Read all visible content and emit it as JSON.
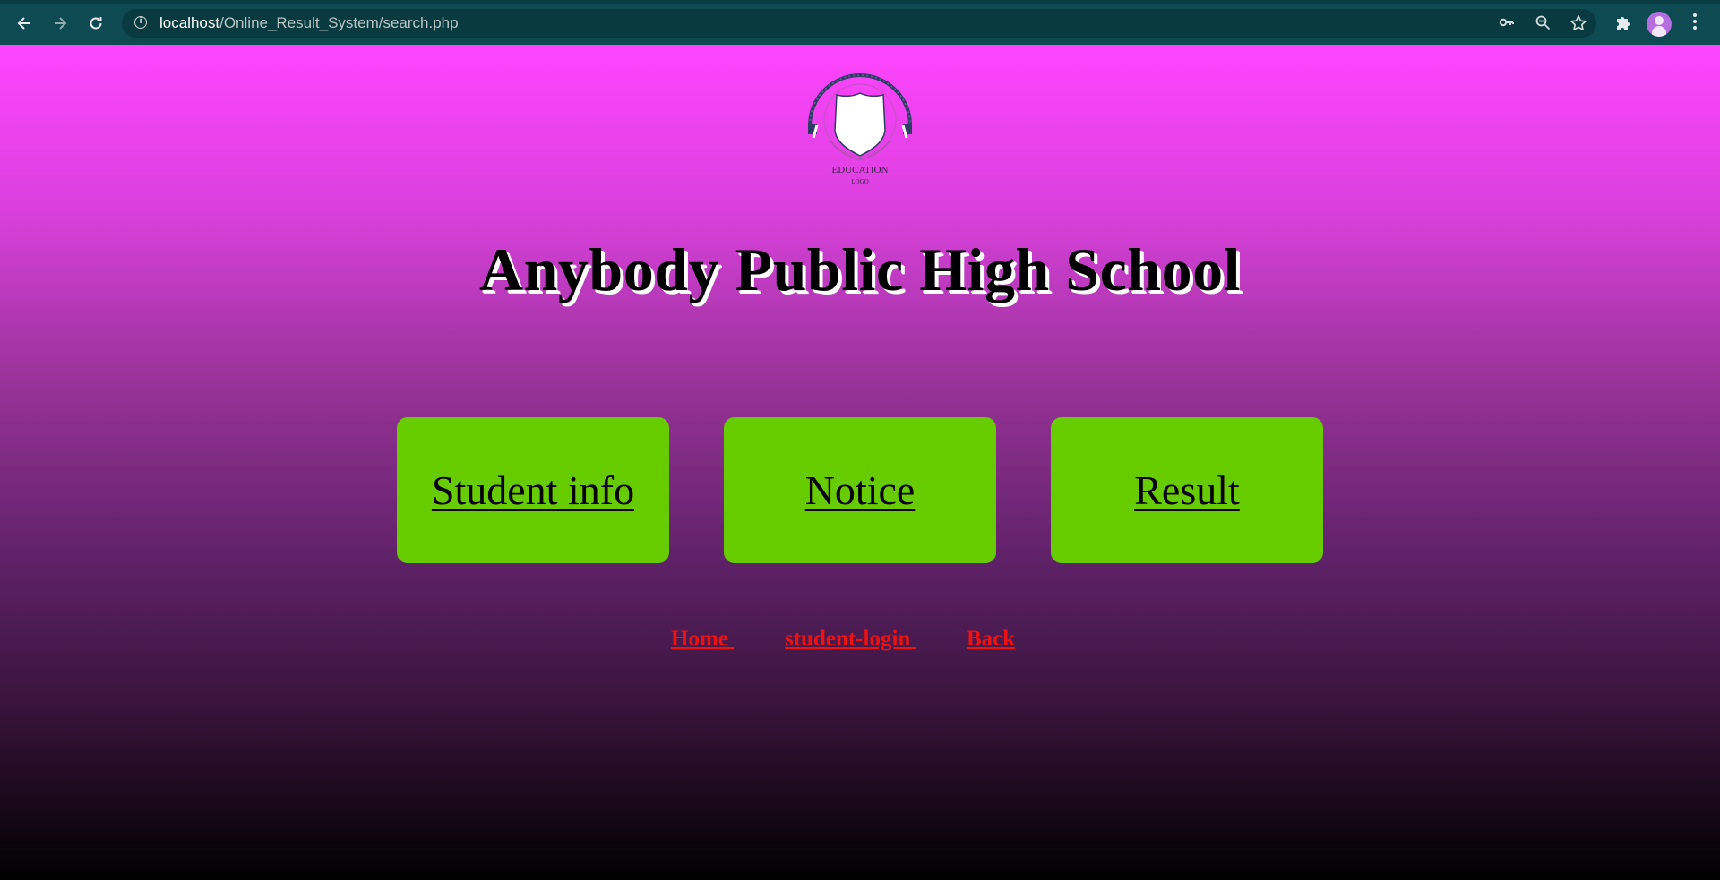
{
  "browser": {
    "url_host": "localhost",
    "url_path": "/Online_Result_System/search.php",
    "icons": {
      "back": "back-arrow-icon",
      "forward": "forward-arrow-icon",
      "reload": "reload-icon",
      "info": "info-icon",
      "key": "key-icon",
      "zoom": "zoom-icon",
      "bookmark": "star-icon",
      "extensions": "puzzle-icon",
      "menu": "kebab-menu-icon"
    },
    "colors": {
      "toolbar": "#0d4a52",
      "omnibox": "#083a40"
    }
  },
  "logo": {
    "line1": "EDUCATION",
    "line2": "LOGO"
  },
  "page": {
    "title": "Anybody Public High School",
    "cards": [
      {
        "label": "Student info"
      },
      {
        "label": "Notice"
      },
      {
        "label": "Result"
      }
    ],
    "footer_links": [
      {
        "label": "Home "
      },
      {
        "label": "student-login "
      },
      {
        "label": "Back"
      }
    ],
    "colors": {
      "card": "#66cc00",
      "footer_link": "#ee1111",
      "gradient_top": "#ff44ff",
      "gradient_bottom": "#000000"
    }
  }
}
